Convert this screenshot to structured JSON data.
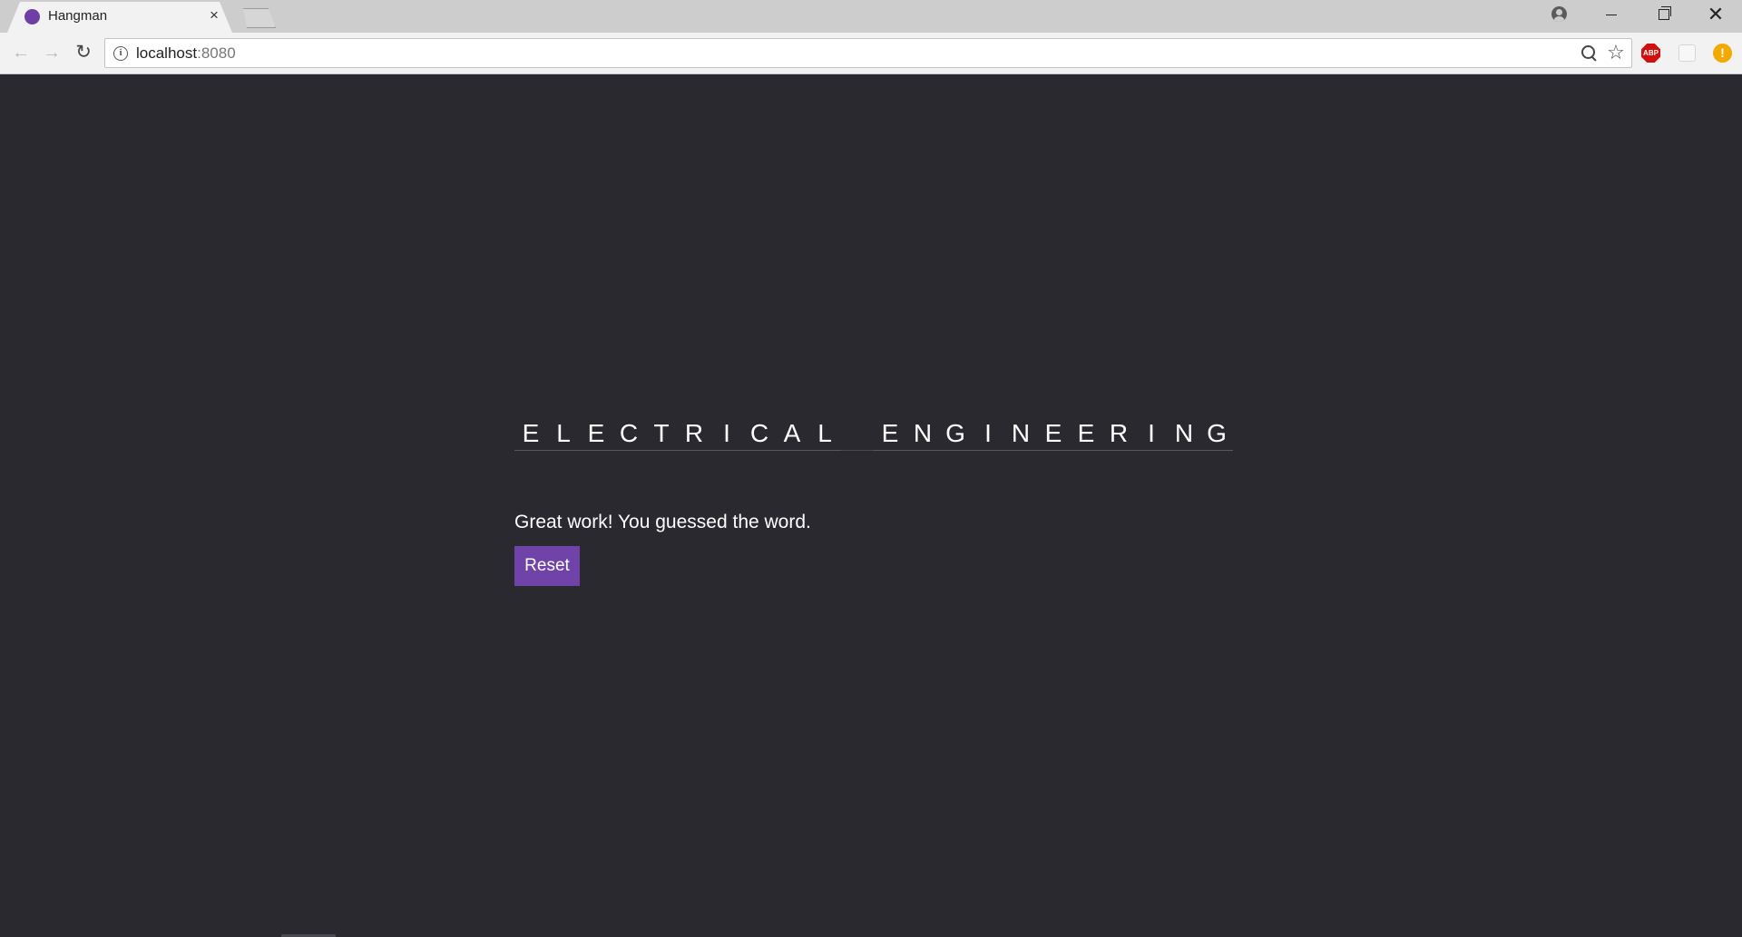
{
  "browser": {
    "tab_title": "Hangman",
    "tab_close_glyph": "×",
    "favicon_color": "#6f3fa6",
    "url_host": "localhost",
    "url_port": ":8080",
    "window_close_glyph": "✕",
    "star_glyph": "☆",
    "abp_label": "ABP",
    "alert_glyph": "!",
    "info_glyph": "i",
    "back_glyph": "←",
    "forward_glyph": "→",
    "reload_glyph": "↻"
  },
  "game": {
    "word": "ELECTRICAL ENGINEERING",
    "letters": [
      "E",
      "L",
      "E",
      "C",
      "T",
      "R",
      "I",
      "C",
      "A",
      "L",
      " ",
      "E",
      "N",
      "G",
      "I",
      "N",
      "E",
      "E",
      "R",
      "I",
      "N",
      "G"
    ],
    "message": "Great work! You guessed the word.",
    "reset_label": "Reset"
  },
  "colors": {
    "page_background": "#2b2930",
    "accent": "#7043a8",
    "text": "#ffffff"
  }
}
